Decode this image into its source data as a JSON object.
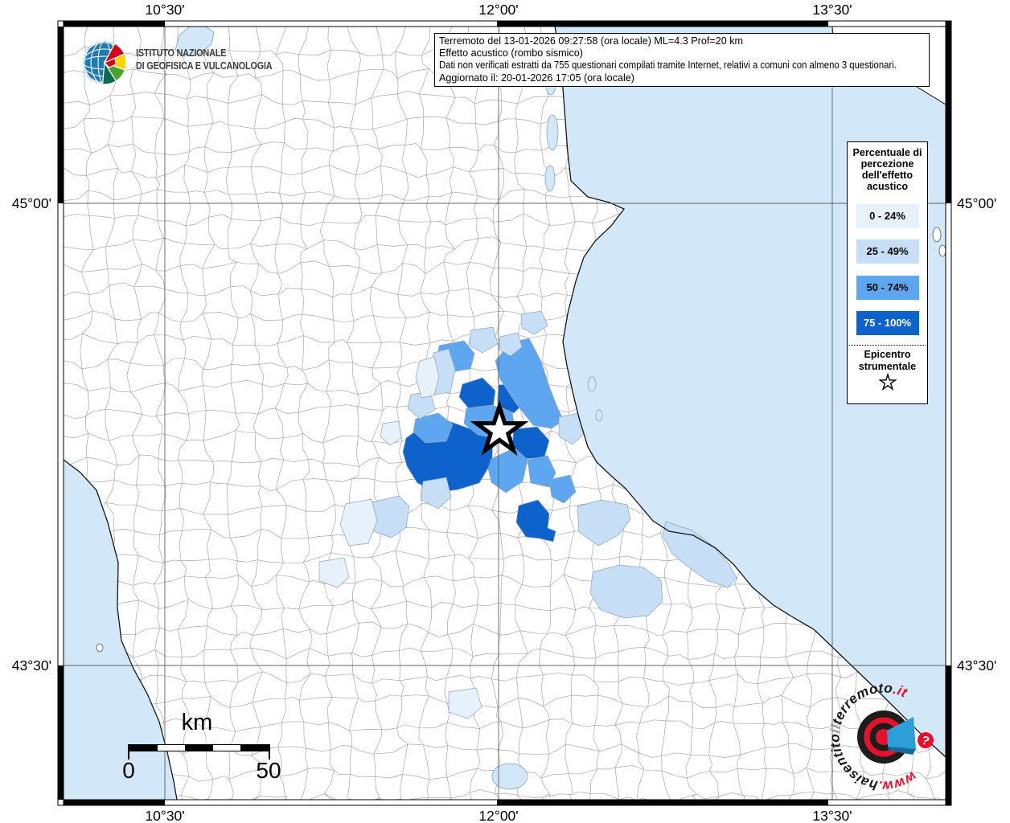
{
  "branding": {
    "name_line1": "ISTITUTO NAZIONALE",
    "name_line2": "DI GEOFISICA E VULCANOLOGIA"
  },
  "info_box": {
    "line1": "Terremoto del 13-01-2026 09:27:58 (ora locale) ML=4.3 Prof=20 km",
    "line2": "Effetto acustico (rombo sismico)",
    "line3": "Dati non verificati estratti da 755 questionari compilati tramite Internet, relativi a comuni con almeno 3 questionari.",
    "line4": "Aggiornato il: 20-01-2026 17:05 (ora locale)"
  },
  "legend": {
    "title": "Percentuale di percezione dell'effetto acustico",
    "classes": [
      {
        "label": "0 - 24%",
        "color": "#E6F1FB"
      },
      {
        "label": "25 - 49%",
        "color": "#C6DEF6"
      },
      {
        "label": "50 - 74%",
        "color": "#5EA7F0"
      },
      {
        "label": "75 - 100%",
        "color": "#0D62CB"
      }
    ],
    "epicenter_title": "Epicentro strumentale",
    "epicenter_symbol": "star-outline"
  },
  "axes": {
    "top": [
      {
        "label": "10°30'"
      },
      {
        "label": "12°00'"
      },
      {
        "label": "13°30'"
      }
    ],
    "bottom": [
      {
        "label": "10°30'"
      },
      {
        "label": "12°00'"
      },
      {
        "label": "13°30'"
      }
    ],
    "left": [
      {
        "label": "45°00'"
      },
      {
        "label": "43°30'"
      }
    ],
    "right": [
      {
        "label": "45°00'"
      },
      {
        "label": "43°30'"
      }
    ]
  },
  "scale_bar": {
    "unit": "km",
    "start_label": "0",
    "end_label": "50"
  },
  "watermark": {
    "segments": [
      {
        "text": "www.",
        "color": "#E8112D"
      },
      {
        "text": "haisentito",
        "color": "#1A1A1A"
      },
      {
        "text": "il",
        "color": "#9A9A9A"
      },
      {
        "text": "terremoto",
        "color": "#1A1A1A"
      },
      {
        "text": ".it",
        "color": "#E8112D"
      }
    ],
    "question_mark": "?"
  },
  "map": {
    "sea_color": "#D2E7F7",
    "land_color": "#FFFFFF",
    "municipality_border_color": "#A9A9A9",
    "coast_color": "#161616",
    "grid_color": "#4A4A4A",
    "epicenter": {
      "symbol": "star"
    }
  }
}
